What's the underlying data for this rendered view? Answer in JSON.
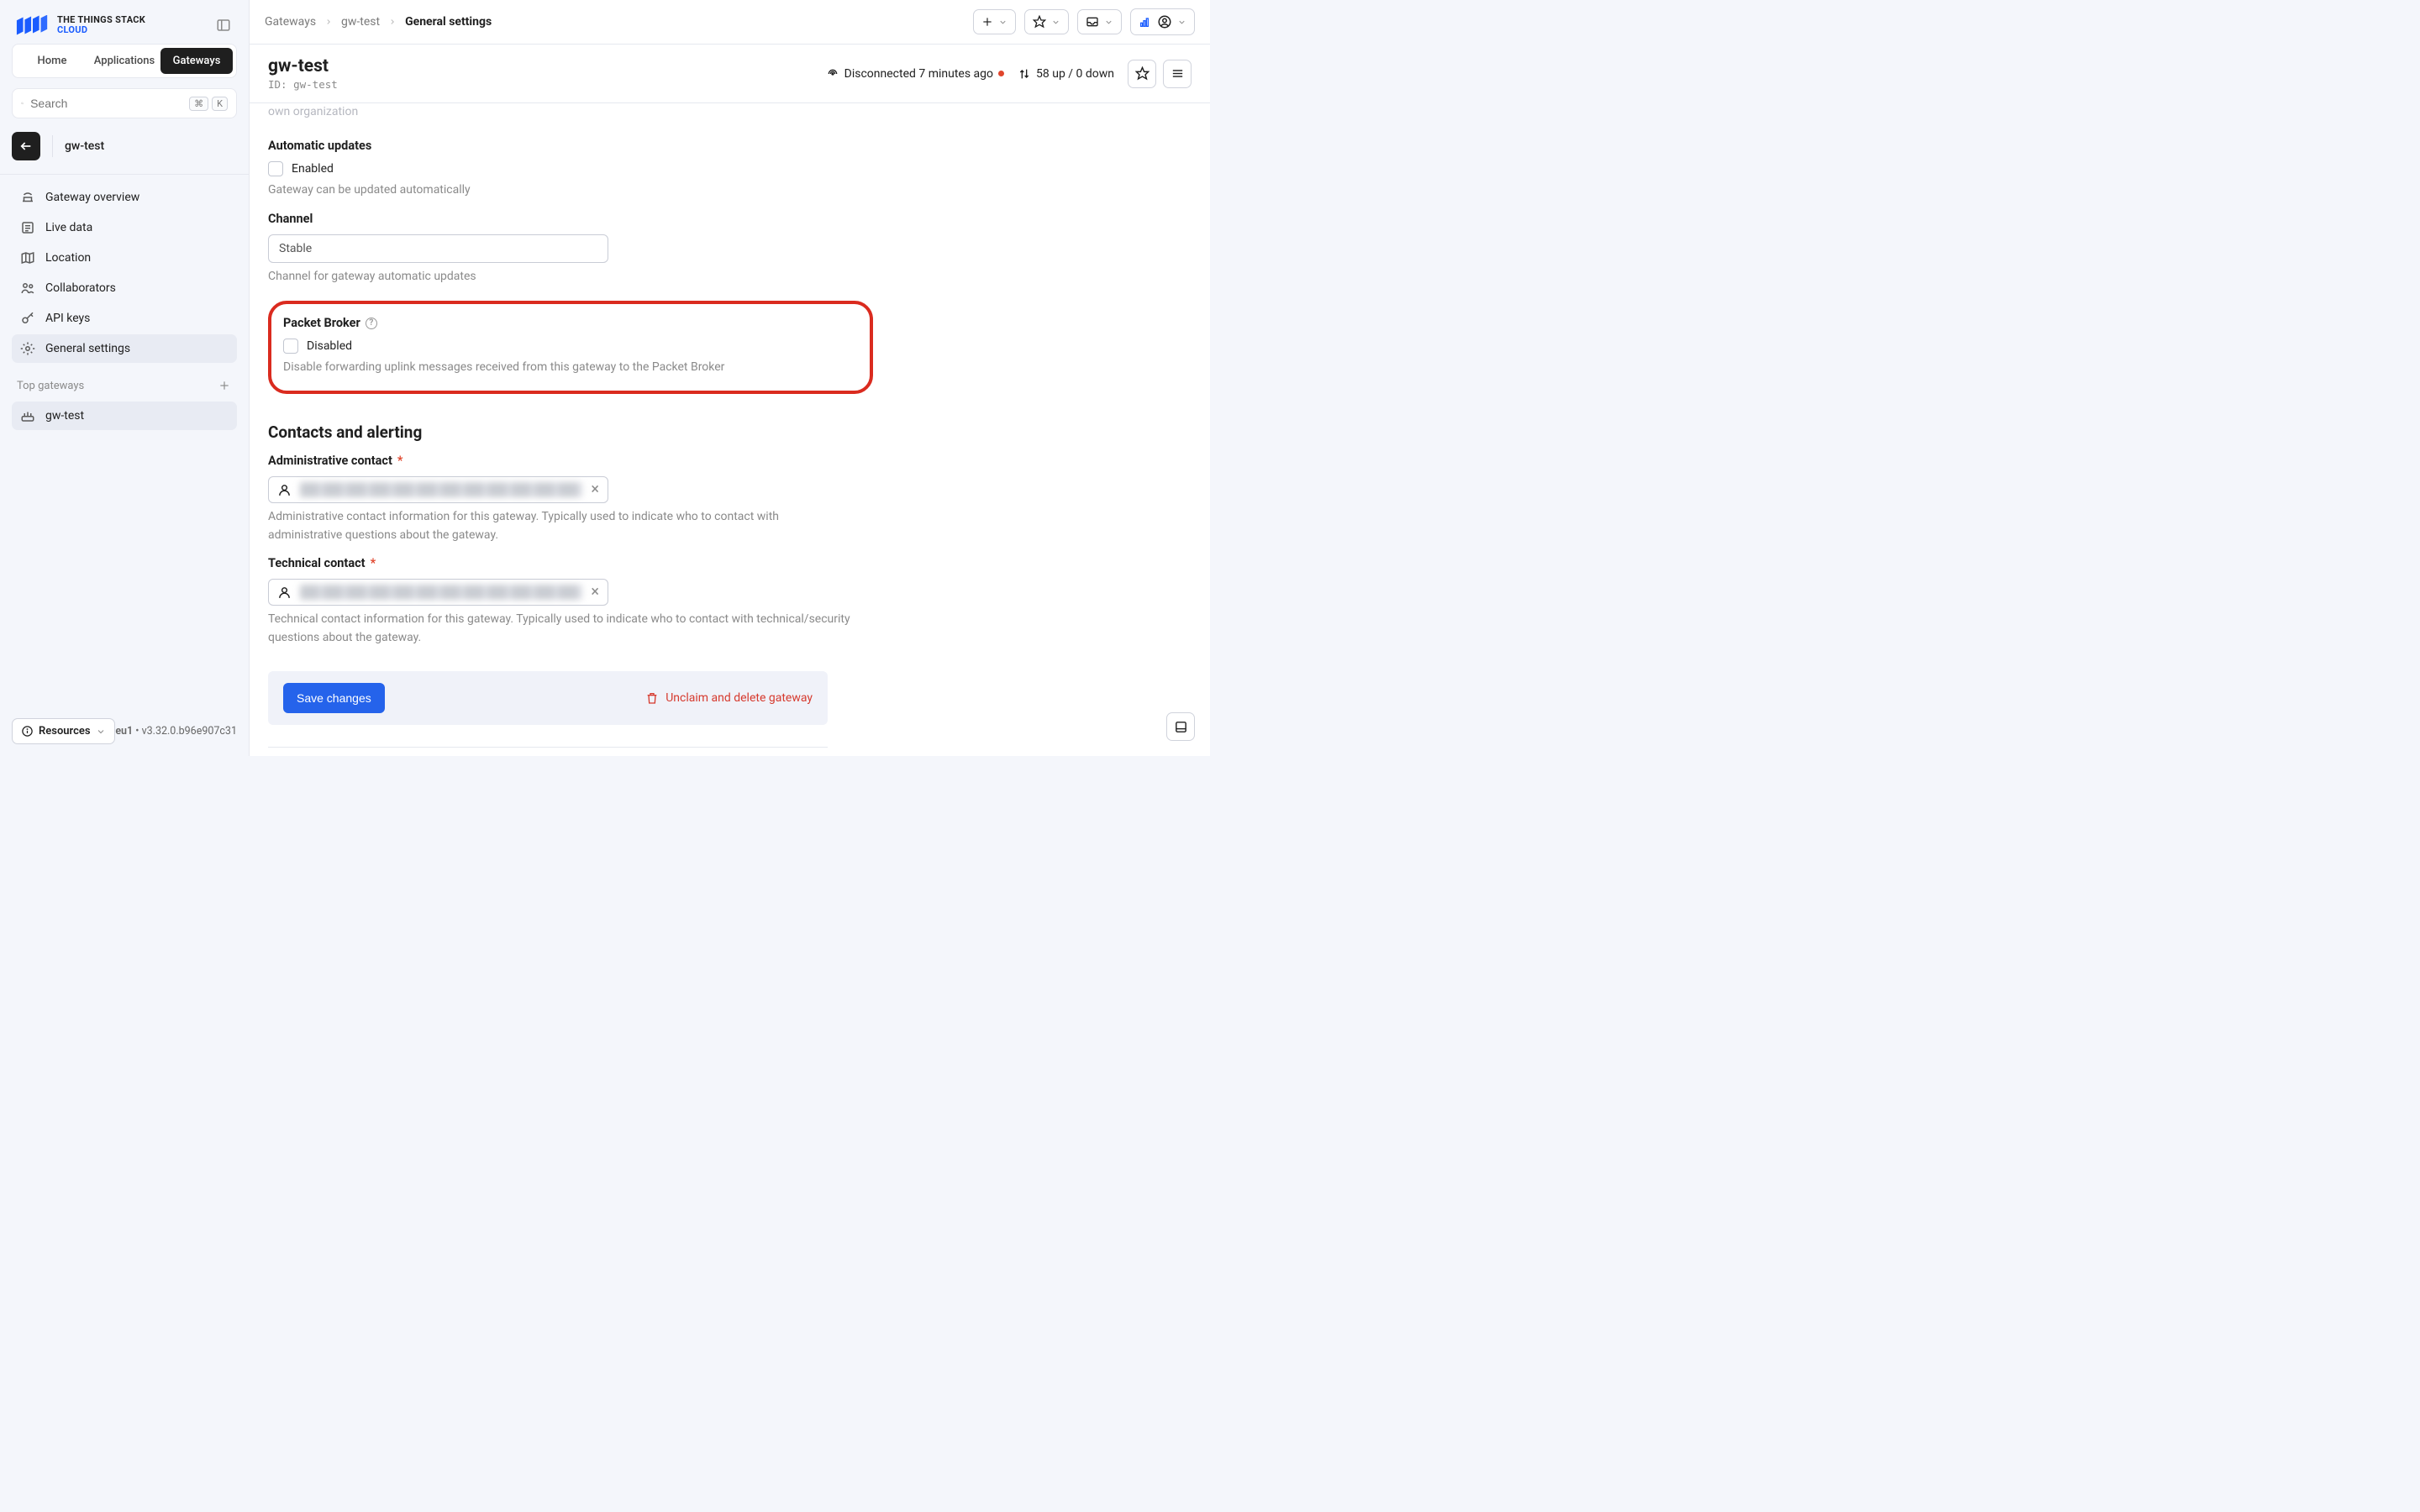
{
  "brand": {
    "line1": "THE THINGS STACK",
    "line2": "CLOUD"
  },
  "nav_tabs": {
    "home": "Home",
    "applications": "Applications",
    "gateways": "Gateways"
  },
  "search": {
    "placeholder": "Search",
    "kbd1": "⌘",
    "kbd2": "K"
  },
  "current_gateway": "gw-test",
  "sidebar_items": {
    "overview": "Gateway overview",
    "live_data": "Live data",
    "location": "Location",
    "collaborators": "Collaborators",
    "api_keys": "API keys",
    "general_settings": "General settings"
  },
  "top_gateways_label": "Top gateways",
  "top_gateway_1": "gw-test",
  "resources_label": "Resources",
  "version": {
    "deployment": "eu1",
    "tag": "v3.32.0.b96e907c31"
  },
  "breadcrumbs": {
    "l1": "Gateways",
    "l2": "gw-test",
    "l3": "General settings"
  },
  "page": {
    "title": "gw-test",
    "id_prefix": "ID: ",
    "id": "gw-test",
    "disconnected": "Disconnected 7 minutes ago",
    "traffic": "58 up / 0 down"
  },
  "form": {
    "cutoff": "own organization",
    "auto_updates": {
      "label": "Automatic updates",
      "checkbox_label": "Enabled",
      "help": "Gateway can be updated automatically"
    },
    "channel": {
      "label": "Channel",
      "value": "Stable",
      "help": "Channel for gateway automatic updates"
    },
    "packet_broker": {
      "label": "Packet Broker",
      "checkbox_label": "Disabled",
      "help": "Disable forwarding uplink messages received from this gateway to the Packet Broker"
    },
    "contacts_title": "Contacts and alerting",
    "admin_contact": {
      "label": "Administrative contact",
      "help": "Administrative contact information for this gateway. Typically used to indicate who to contact with administrative questions about the gateway."
    },
    "tech_contact": {
      "label": "Technical contact",
      "help": "Technical contact information for this gateway. Typically used to indicate who to contact with technical/security questions about the gateway."
    },
    "save_label": "Save changes",
    "delete_label": "Unclaim and delete gateway"
  }
}
